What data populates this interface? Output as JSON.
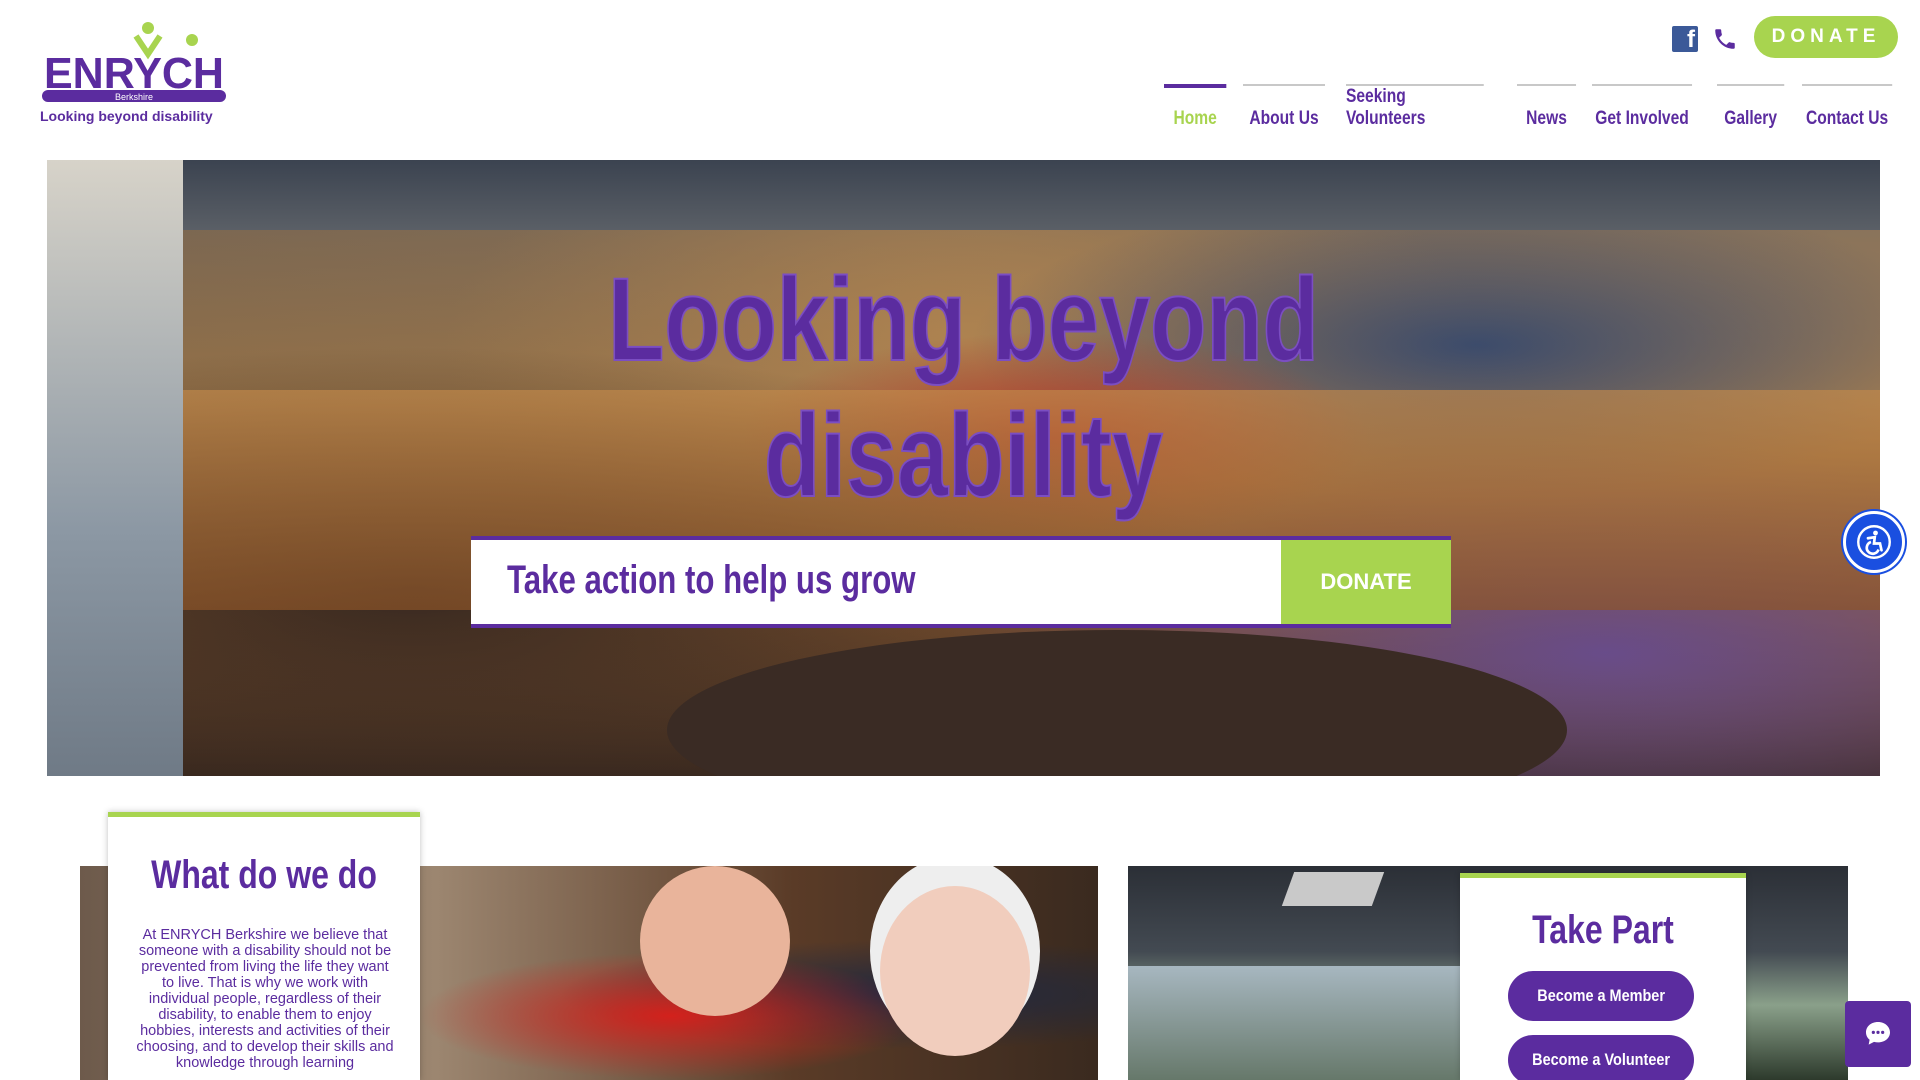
{
  "brand": {
    "logo_text": "ENRYCH",
    "logo_region": "Berkshire",
    "tagline": "Looking beyond disability"
  },
  "header": {
    "donate_label": "DONATE",
    "social_icons": [
      "facebook-icon",
      "phone-icon"
    ]
  },
  "nav": {
    "items": [
      {
        "label": "Home",
        "active": true
      },
      {
        "label": "About Us",
        "active": false
      },
      {
        "label": "Seeking Volunteers",
        "active": false
      },
      {
        "label": "News",
        "active": false
      },
      {
        "label": "Get Involved",
        "active": false
      },
      {
        "label": "Gallery",
        "active": false
      },
      {
        "label": "Contact Us",
        "active": false
      }
    ]
  },
  "hero": {
    "title_line1": "Looking beyond",
    "title_line2": "disability",
    "cta_text": "Take action to help us grow",
    "cta_button": "DONATE"
  },
  "what": {
    "title": "What do we do",
    "body": "At ENRYCH Berkshire we believe that someone with a disability should not be prevented from living the life they want to live.  That is why we work with individual people, regardless of their disability, to enable them to enjoy hobbies, interests and activities of their choosing, and to develop their skills and knowledge through learning"
  },
  "take_part": {
    "title": "Take Part",
    "buttons": [
      "Become a Member",
      "Become a Volunteer"
    ]
  },
  "colors": {
    "purple": "#5b2c9f",
    "green": "#a8d44f",
    "accessibility_blue": "#1a4fe0"
  },
  "icons": [
    "accessibility-icon",
    "chat-icon"
  ]
}
